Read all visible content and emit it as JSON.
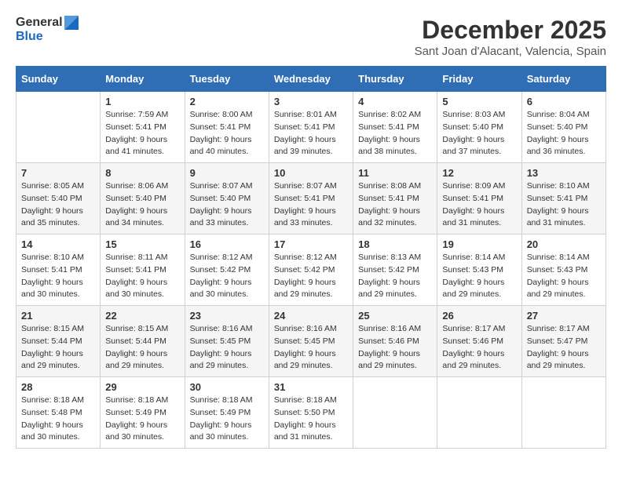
{
  "logo": {
    "general": "General",
    "blue": "Blue"
  },
  "title": "December 2025",
  "subtitle": "Sant Joan d'Alacant, Valencia, Spain",
  "days_of_week": [
    "Sunday",
    "Monday",
    "Tuesday",
    "Wednesday",
    "Thursday",
    "Friday",
    "Saturday"
  ],
  "weeks": [
    [
      {
        "day": "",
        "sunrise": "",
        "sunset": "",
        "daylight": ""
      },
      {
        "day": "1",
        "sunrise": "Sunrise: 7:59 AM",
        "sunset": "Sunset: 5:41 PM",
        "daylight": "Daylight: 9 hours and 41 minutes."
      },
      {
        "day": "2",
        "sunrise": "Sunrise: 8:00 AM",
        "sunset": "Sunset: 5:41 PM",
        "daylight": "Daylight: 9 hours and 40 minutes."
      },
      {
        "day": "3",
        "sunrise": "Sunrise: 8:01 AM",
        "sunset": "Sunset: 5:41 PM",
        "daylight": "Daylight: 9 hours and 39 minutes."
      },
      {
        "day": "4",
        "sunrise": "Sunrise: 8:02 AM",
        "sunset": "Sunset: 5:41 PM",
        "daylight": "Daylight: 9 hours and 38 minutes."
      },
      {
        "day": "5",
        "sunrise": "Sunrise: 8:03 AM",
        "sunset": "Sunset: 5:40 PM",
        "daylight": "Daylight: 9 hours and 37 minutes."
      },
      {
        "day": "6",
        "sunrise": "Sunrise: 8:04 AM",
        "sunset": "Sunset: 5:40 PM",
        "daylight": "Daylight: 9 hours and 36 minutes."
      }
    ],
    [
      {
        "day": "7",
        "sunrise": "Sunrise: 8:05 AM",
        "sunset": "Sunset: 5:40 PM",
        "daylight": "Daylight: 9 hours and 35 minutes."
      },
      {
        "day": "8",
        "sunrise": "Sunrise: 8:06 AM",
        "sunset": "Sunset: 5:40 PM",
        "daylight": "Daylight: 9 hours and 34 minutes."
      },
      {
        "day": "9",
        "sunrise": "Sunrise: 8:07 AM",
        "sunset": "Sunset: 5:40 PM",
        "daylight": "Daylight: 9 hours and 33 minutes."
      },
      {
        "day": "10",
        "sunrise": "Sunrise: 8:07 AM",
        "sunset": "Sunset: 5:41 PM",
        "daylight": "Daylight: 9 hours and 33 minutes."
      },
      {
        "day": "11",
        "sunrise": "Sunrise: 8:08 AM",
        "sunset": "Sunset: 5:41 PM",
        "daylight": "Daylight: 9 hours and 32 minutes."
      },
      {
        "day": "12",
        "sunrise": "Sunrise: 8:09 AM",
        "sunset": "Sunset: 5:41 PM",
        "daylight": "Daylight: 9 hours and 31 minutes."
      },
      {
        "day": "13",
        "sunrise": "Sunrise: 8:10 AM",
        "sunset": "Sunset: 5:41 PM",
        "daylight": "Daylight: 9 hours and 31 minutes."
      }
    ],
    [
      {
        "day": "14",
        "sunrise": "Sunrise: 8:10 AM",
        "sunset": "Sunset: 5:41 PM",
        "daylight": "Daylight: 9 hours and 30 minutes."
      },
      {
        "day": "15",
        "sunrise": "Sunrise: 8:11 AM",
        "sunset": "Sunset: 5:41 PM",
        "daylight": "Daylight: 9 hours and 30 minutes."
      },
      {
        "day": "16",
        "sunrise": "Sunrise: 8:12 AM",
        "sunset": "Sunset: 5:42 PM",
        "daylight": "Daylight: 9 hours and 30 minutes."
      },
      {
        "day": "17",
        "sunrise": "Sunrise: 8:12 AM",
        "sunset": "Sunset: 5:42 PM",
        "daylight": "Daylight: 9 hours and 29 minutes."
      },
      {
        "day": "18",
        "sunrise": "Sunrise: 8:13 AM",
        "sunset": "Sunset: 5:42 PM",
        "daylight": "Daylight: 9 hours and 29 minutes."
      },
      {
        "day": "19",
        "sunrise": "Sunrise: 8:14 AM",
        "sunset": "Sunset: 5:43 PM",
        "daylight": "Daylight: 9 hours and 29 minutes."
      },
      {
        "day": "20",
        "sunrise": "Sunrise: 8:14 AM",
        "sunset": "Sunset: 5:43 PM",
        "daylight": "Daylight: 9 hours and 29 minutes."
      }
    ],
    [
      {
        "day": "21",
        "sunrise": "Sunrise: 8:15 AM",
        "sunset": "Sunset: 5:44 PM",
        "daylight": "Daylight: 9 hours and 29 minutes."
      },
      {
        "day": "22",
        "sunrise": "Sunrise: 8:15 AM",
        "sunset": "Sunset: 5:44 PM",
        "daylight": "Daylight: 9 hours and 29 minutes."
      },
      {
        "day": "23",
        "sunrise": "Sunrise: 8:16 AM",
        "sunset": "Sunset: 5:45 PM",
        "daylight": "Daylight: 9 hours and 29 minutes."
      },
      {
        "day": "24",
        "sunrise": "Sunrise: 8:16 AM",
        "sunset": "Sunset: 5:45 PM",
        "daylight": "Daylight: 9 hours and 29 minutes."
      },
      {
        "day": "25",
        "sunrise": "Sunrise: 8:16 AM",
        "sunset": "Sunset: 5:46 PM",
        "daylight": "Daylight: 9 hours and 29 minutes."
      },
      {
        "day": "26",
        "sunrise": "Sunrise: 8:17 AM",
        "sunset": "Sunset: 5:46 PM",
        "daylight": "Daylight: 9 hours and 29 minutes."
      },
      {
        "day": "27",
        "sunrise": "Sunrise: 8:17 AM",
        "sunset": "Sunset: 5:47 PM",
        "daylight": "Daylight: 9 hours and 29 minutes."
      }
    ],
    [
      {
        "day": "28",
        "sunrise": "Sunrise: 8:18 AM",
        "sunset": "Sunset: 5:48 PM",
        "daylight": "Daylight: 9 hours and 30 minutes."
      },
      {
        "day": "29",
        "sunrise": "Sunrise: 8:18 AM",
        "sunset": "Sunset: 5:49 PM",
        "daylight": "Daylight: 9 hours and 30 minutes."
      },
      {
        "day": "30",
        "sunrise": "Sunrise: 8:18 AM",
        "sunset": "Sunset: 5:49 PM",
        "daylight": "Daylight: 9 hours and 30 minutes."
      },
      {
        "day": "31",
        "sunrise": "Sunrise: 8:18 AM",
        "sunset": "Sunset: 5:50 PM",
        "daylight": "Daylight: 9 hours and 31 minutes."
      },
      {
        "day": "",
        "sunrise": "",
        "sunset": "",
        "daylight": ""
      },
      {
        "day": "",
        "sunrise": "",
        "sunset": "",
        "daylight": ""
      },
      {
        "day": "",
        "sunrise": "",
        "sunset": "",
        "daylight": ""
      }
    ]
  ]
}
